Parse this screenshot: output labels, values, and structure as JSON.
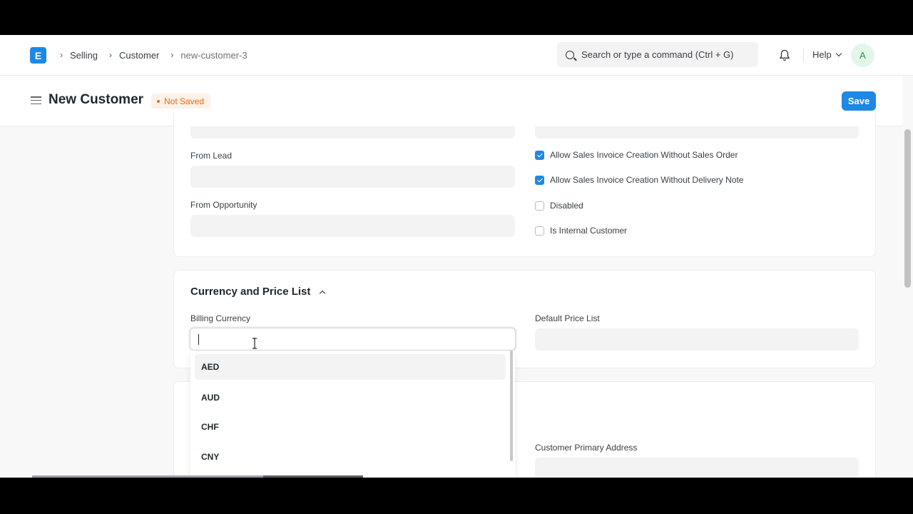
{
  "navbar": {
    "logo_letter": "E",
    "breadcrumbs": [
      "Selling",
      "Customer",
      "new-customer-3"
    ],
    "search_placeholder": "Search or type a command (Ctrl + G)",
    "help_label": "Help",
    "avatar_letter": "A"
  },
  "page_head": {
    "title": "New Customer",
    "status": "Not Saved",
    "save_label": "Save"
  },
  "details": {
    "from_lead_label": "From Lead",
    "from_opportunity_label": "From Opportunity",
    "checkboxes": [
      {
        "label": "Allow Sales Invoice Creation Without Sales Order",
        "checked": true
      },
      {
        "label": "Allow Sales Invoice Creation Without Delivery Note",
        "checked": true
      },
      {
        "label": "Disabled",
        "checked": false
      },
      {
        "label": "Is Internal Customer",
        "checked": false
      }
    ]
  },
  "currency_section": {
    "title": "Currency and Price List",
    "billing_currency_label": "Billing Currency",
    "billing_currency_value": "",
    "default_price_list_label": "Default Price List",
    "options": [
      "AED",
      "AUD",
      "CHF",
      "CNY"
    ],
    "highlighted_option": "AED"
  },
  "address_section": {
    "customer_primary_address_label": "Customer Primary Address"
  },
  "colors": {
    "primary": "#1e88e5",
    "status_orange": "#e86c13",
    "field_bg": "#f3f3f3"
  }
}
